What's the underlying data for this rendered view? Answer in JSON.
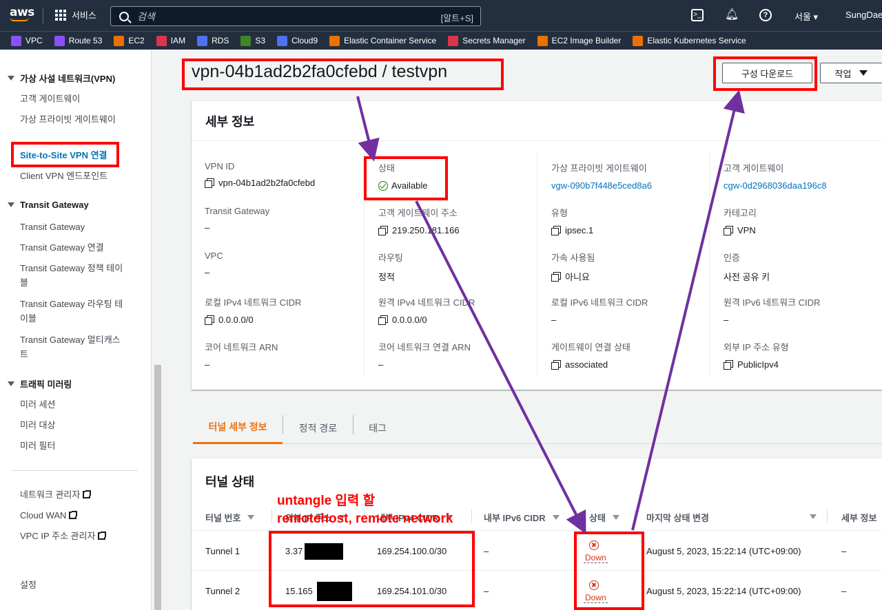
{
  "topnav": {
    "logo_text": "aws",
    "services_label": "서비스",
    "search_placeholder": "검색",
    "search_shortcut": "[알트+S]",
    "cloudshell_icon": "cloudshell-icon",
    "bell_icon": "bell-icon",
    "help_icon": "help-icon",
    "region": "서울 ▾",
    "user": "SungDae,"
  },
  "favorites": [
    {
      "label": "VPC",
      "color": "#8c4fff"
    },
    {
      "label": "Route 53",
      "color": "#8c4fff"
    },
    {
      "label": "EC2",
      "color": "#ed7100"
    },
    {
      "label": "IAM",
      "color": "#dd344c"
    },
    {
      "label": "RDS",
      "color": "#4d72f3"
    },
    {
      "label": "S3",
      "color": "#3f8624"
    },
    {
      "label": "Cloud9",
      "color": "#4d72f3"
    },
    {
      "label": "Elastic Container Service",
      "color": "#ed7100"
    },
    {
      "label": "Secrets Manager",
      "color": "#dd344c"
    },
    {
      "label": "EC2 Image Builder",
      "color": "#ed7100"
    },
    {
      "label": "Elastic Kubernetes Service",
      "color": "#ed7100"
    }
  ],
  "sidebar": {
    "vpn_section": "가상 사설 네트워크(VPN)",
    "vpn_items": [
      "고객 게이트웨이",
      "가상 프라이빗 게이트웨이",
      "Site-to-Site VPN 연결",
      "Client VPN 엔드포인트"
    ],
    "tgw_section": "Transit Gateway",
    "tgw_items": [
      "Transit Gateway",
      "Transit Gateway 연결",
      "Transit Gateway 정책 테이블",
      "Transit Gateway 라우팅 테이블",
      "Transit Gateway 멀티캐스트"
    ],
    "mirror_section": "트래픽 미러링",
    "mirror_items": [
      "미러 세션",
      "미러 대상",
      "미러 필터"
    ],
    "ext_items": [
      "네트워크 관리자",
      "Cloud WAN",
      "VPC IP 주소 관리자"
    ],
    "settings": "설정"
  },
  "header": {
    "title": "vpn-04b1ad2b2fa0cfebd / testvpn",
    "download_button": "구성 다운로드",
    "action_button": "작업"
  },
  "details": {
    "title": "세부 정보",
    "vpn_id_label": "VPN ID",
    "vpn_id": "vpn-04b1ad2b2fa0cfebd",
    "state_label": "상태",
    "state": "Available",
    "vgw_label": "가상 프라이빗 게이트웨이",
    "vgw": "vgw-090b7f448e5ced8a6",
    "cgw_label": "고객 게이트웨이",
    "cgw": "cgw-0d2968036daa196c8",
    "tgw_label": "Transit Gateway",
    "tgw": "–",
    "cgw_addr_label": "고객 게이트웨이 주소",
    "cgw_addr": "219.250.181.166",
    "type_label": "유형",
    "type": "ipsec.1",
    "category_label": "카테고리",
    "category": "VPN",
    "vpc_label": "VPC",
    "vpc": "–",
    "routing_label": "라우팅",
    "routing": "정적",
    "accel_label": "가속 사용됨",
    "accel": "아니요",
    "auth_label": "인증",
    "auth": "사전 공유 키",
    "local_v4_label": "로컬 IPv4 네트워크 CIDR",
    "local_v4": "0.0.0.0/0",
    "remote_v4_label": "원격 IPv4 네트워크 CIDR",
    "remote_v4": "0.0.0.0/0",
    "local_v6_label": "로컬 IPv6 네트워크 CIDR",
    "local_v6": "–",
    "remote_v6_label": "원격 IPv6 네트워크 CIDR",
    "remote_v6": "–",
    "core_arn_label": "코어 네트워크 ARN",
    "core_arn": "–",
    "core_attach_label": "코어 네트워크 연결 ARN",
    "core_attach": "–",
    "gw_assoc_label": "게이트웨이 연결 상태",
    "gw_assoc": "associated",
    "ext_ip_type_label": "외부 IP 주소 유형",
    "ext_ip_type": "PublicIpv4"
  },
  "tabs": [
    "터널 세부 정보",
    "정적 경로",
    "태그"
  ],
  "tunnels": {
    "title": "터널 상태",
    "columns": [
      "터널 번호",
      "외부 IP 주소",
      "내부 IPv4 CIDR",
      "내부 IPv6 CIDR",
      "상태",
      "마지막 상태 변경",
      "세부 정보"
    ],
    "rows": [
      {
        "name": "Tunnel 1",
        "outside_ip": "3.37",
        "inside_v4": "169.254.100.0/30",
        "inside_v6": "–",
        "status": "Down",
        "changed": "August 5, 2023, 15:22:14 (UTC+09:00)",
        "details": "–"
      },
      {
        "name": "Tunnel 2",
        "outside_ip": "15.165",
        "inside_v4": "169.254.101.0/30",
        "inside_v6": "–",
        "status": "Down",
        "changed": "August 5, 2023, 15:22:14 (UTC+09:00)",
        "details": "–"
      }
    ]
  },
  "annotations": {
    "note1": "untangle 입력 할",
    "note2": "remotehost,    remote network",
    "color": "#ff0000",
    "arrow_color": "#7030a0"
  }
}
